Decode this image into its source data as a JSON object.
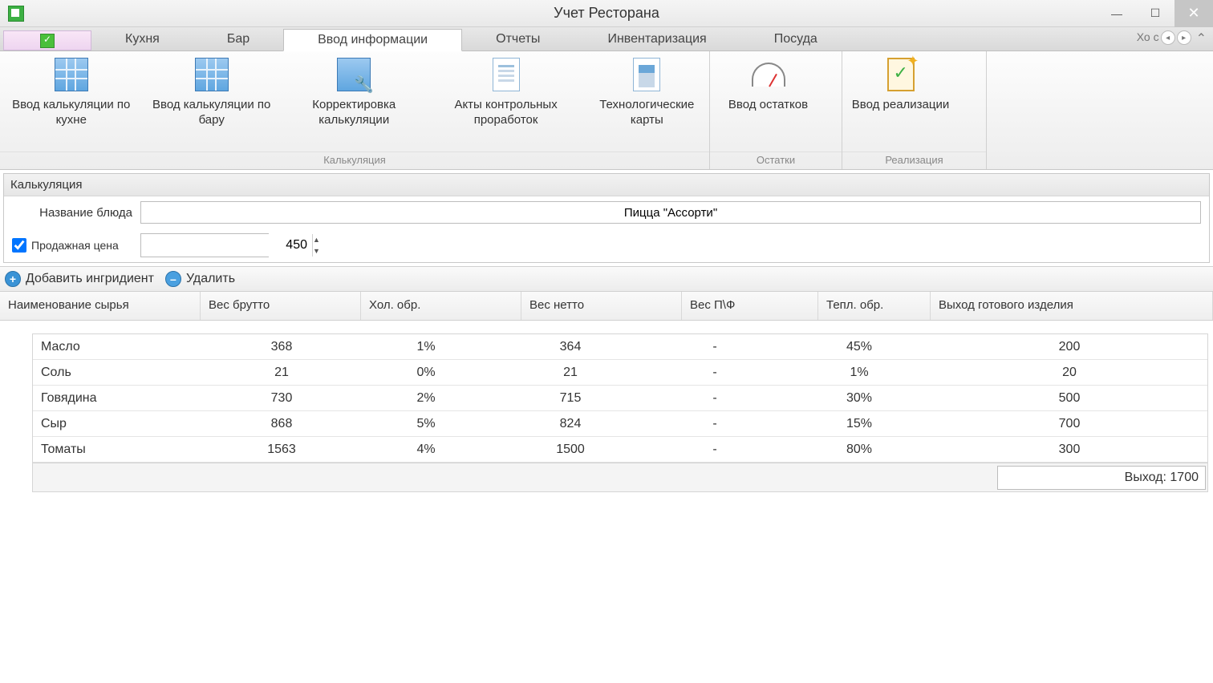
{
  "window": {
    "title": "Учет Ресторана"
  },
  "tabs": {
    "kitchen": "Кухня",
    "bar": "Бар",
    "input": "Ввод информации",
    "reports": "Отчеты",
    "inventory": "Инвентаризация",
    "dishes": "Посуда",
    "overflow": "Хо с"
  },
  "ribbon": {
    "calc_kitchen": "Ввод калькуляции по кухне",
    "calc_bar": "Ввод калькуляции по бару",
    "calc_correct": "Корректировка калькуляции",
    "acts": "Акты контрольных проработок",
    "tech_cards": "Технологические карты",
    "balances": "Ввод остатков",
    "realization": "Ввод реализации",
    "group_calc": "Калькуляция",
    "group_bal": "Остатки",
    "group_real": "Реализация"
  },
  "form": {
    "panel_title": "Калькуляция",
    "dish_label": "Название блюда",
    "dish_value": "Пицца \"Ассорти\"",
    "price_label": "Продажная цена",
    "price_value": "450"
  },
  "toolbar": {
    "add": "Добавить ингридиент",
    "del": "Удалить"
  },
  "grid": {
    "headers": {
      "name": "Наименование сырья",
      "brutto": "Вес брутто",
      "cold": "Хол. обр.",
      "netto": "Вес нетто",
      "pf": "Вес П\\Ф",
      "heat": "Тепл. обр.",
      "out": "Выход готового изделия"
    },
    "rows": [
      {
        "name": "Масло",
        "brutto": "368",
        "cold": "1%",
        "netto": "364",
        "pf": "-",
        "heat": "45%",
        "out": "200"
      },
      {
        "name": "Соль",
        "brutto": "21",
        "cold": "0%",
        "netto": "21",
        "pf": "-",
        "heat": "1%",
        "out": "20"
      },
      {
        "name": "Говядина",
        "brutto": "730",
        "cold": "2%",
        "netto": "715",
        "pf": "-",
        "heat": "30%",
        "out": "500"
      },
      {
        "name": "Сыр",
        "brutto": "868",
        "cold": "5%",
        "netto": "824",
        "pf": "-",
        "heat": "15%",
        "out": "700"
      },
      {
        "name": "Томаты",
        "brutto": "1563",
        "cold": "4%",
        "netto": "1500",
        "pf": "-",
        "heat": "80%",
        "out": "300"
      }
    ],
    "summary": "Выход: 1700"
  }
}
